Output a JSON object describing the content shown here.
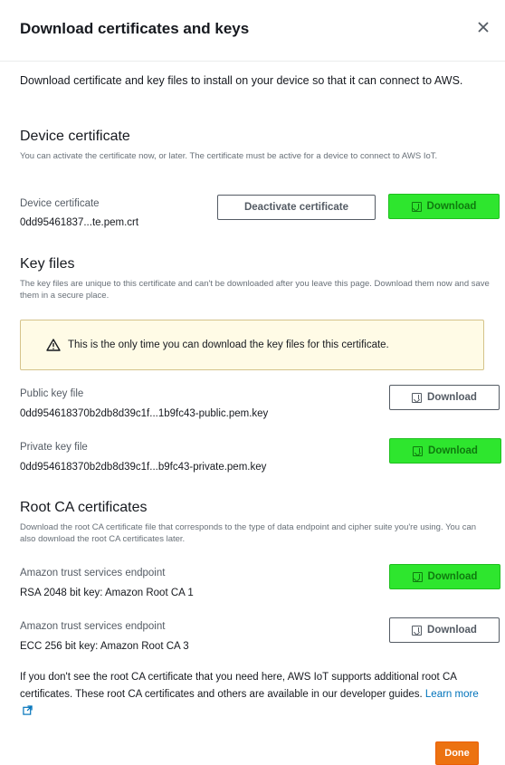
{
  "modal": {
    "title": "Download certificates and keys",
    "intro": "Download certificate and key files to install on your device so that it can connect to AWS."
  },
  "device_certificate": {
    "heading": "Device certificate",
    "description": "You can activate the certificate now, or later. The certificate must be active for a device to connect to AWS IoT.",
    "label": "Device certificate",
    "file": "0dd95461837...te.pem.crt",
    "deactivate_label": "Deactivate certificate",
    "download_label": "Download"
  },
  "key_files": {
    "heading": "Key files",
    "description": "The key files are unique to this certificate and can't be downloaded after you leave this page. Download them now and save them in a secure place.",
    "alert": "This is the only time you can download the key files for this certificate.",
    "public": {
      "label": "Public key file",
      "file": "0dd954618370b2db8d39c1f...1b9fc43-public.pem.key",
      "download_label": "Download"
    },
    "private": {
      "label": "Private key file",
      "file": "0dd954618370b2db8d39c1f...b9fc43-private.pem.key",
      "download_label": "Download"
    }
  },
  "root_ca": {
    "heading": "Root CA certificates",
    "description": "Download the root CA certificate file that corresponds to the type of data endpoint and cipher suite you're using. You can also download the root CA certificates later.",
    "rsa": {
      "label": "Amazon trust services endpoint",
      "file": "RSA 2048 bit key: Amazon Root CA 1",
      "download_label": "Download"
    },
    "ecc": {
      "label": "Amazon trust services endpoint",
      "file": "ECC 256 bit key: Amazon Root CA 3",
      "download_label": "Download"
    }
  },
  "footnote": {
    "text": "If you don't see the root CA certificate that you need here, AWS IoT supports additional root CA certificates. These root CA certificates and others are available in our developer guides.",
    "link": "Learn more"
  },
  "footer": {
    "done_label": "Done"
  },
  "colors": {
    "highlight_green": "#2ee62e",
    "primary_orange": "#ec7211",
    "link_blue": "#0073bb",
    "alert_bg": "#fffbe6"
  },
  "icons": [
    "close-icon",
    "download-icon",
    "warning-icon",
    "external-link-icon"
  ]
}
